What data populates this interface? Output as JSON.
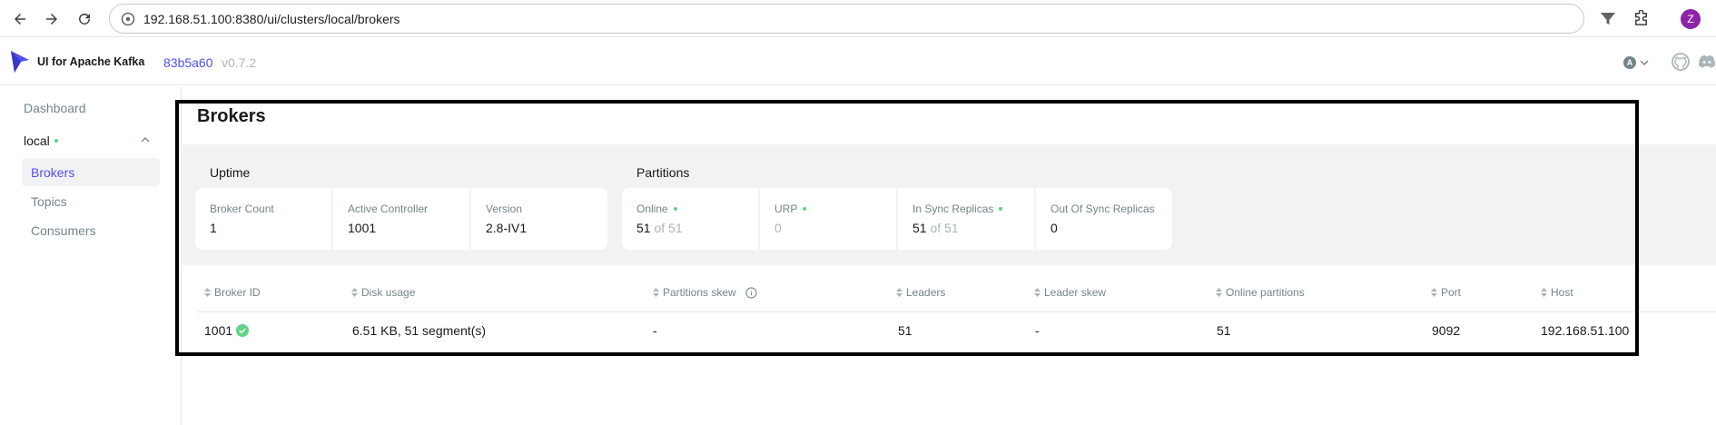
{
  "browser": {
    "url": "192.168.51.100:8380/ui/clusters/local/brokers",
    "profile_initial": "Z"
  },
  "header": {
    "app_name": "UI for Apache Kafka",
    "commit": "83b5a60",
    "version": "v0.7.2",
    "theme_badge": "A"
  },
  "sidebar": {
    "dashboard": "Dashboard",
    "cluster": "local",
    "items": [
      {
        "label": "Brokers",
        "active": true
      },
      {
        "label": "Topics",
        "active": false
      },
      {
        "label": "Consumers",
        "active": false
      }
    ]
  },
  "page": {
    "title": "Brokers"
  },
  "uptime": {
    "title": "Uptime",
    "cards": [
      {
        "label": "Broker Count",
        "value": "1"
      },
      {
        "label": "Active Controller",
        "value": "1001"
      },
      {
        "label": "Version",
        "value": "2.8-IV1"
      }
    ]
  },
  "partitions": {
    "title": "Partitions",
    "cards": [
      {
        "label": "Online",
        "value": "51",
        "suffix": "of 51"
      },
      {
        "label": "URP",
        "value": "0"
      },
      {
        "label": "In Sync Replicas",
        "value": "51",
        "suffix": "of 51"
      },
      {
        "label": "Out Of Sync Replicas",
        "value": "0"
      }
    ]
  },
  "table": {
    "columns": [
      "Broker ID",
      "Disk usage",
      "Partitions skew",
      "Leaders",
      "Leader skew",
      "Online partitions",
      "Port",
      "Host"
    ],
    "rows": [
      {
        "broker_id": "1001",
        "disk_usage": "6.51 KB, 51 segment(s)",
        "partitions_skew": "-",
        "leaders": "51",
        "leader_skew": "-",
        "online_partitions": "51",
        "port": "9092",
        "host": "192.168.51.100"
      }
    ]
  },
  "colors": {
    "accent": "#4f4ff0",
    "online": "#5cd685",
    "muted": "#abb5ba",
    "label": "#73848c",
    "band": "#f1f2f3",
    "frame": "#000000"
  }
}
